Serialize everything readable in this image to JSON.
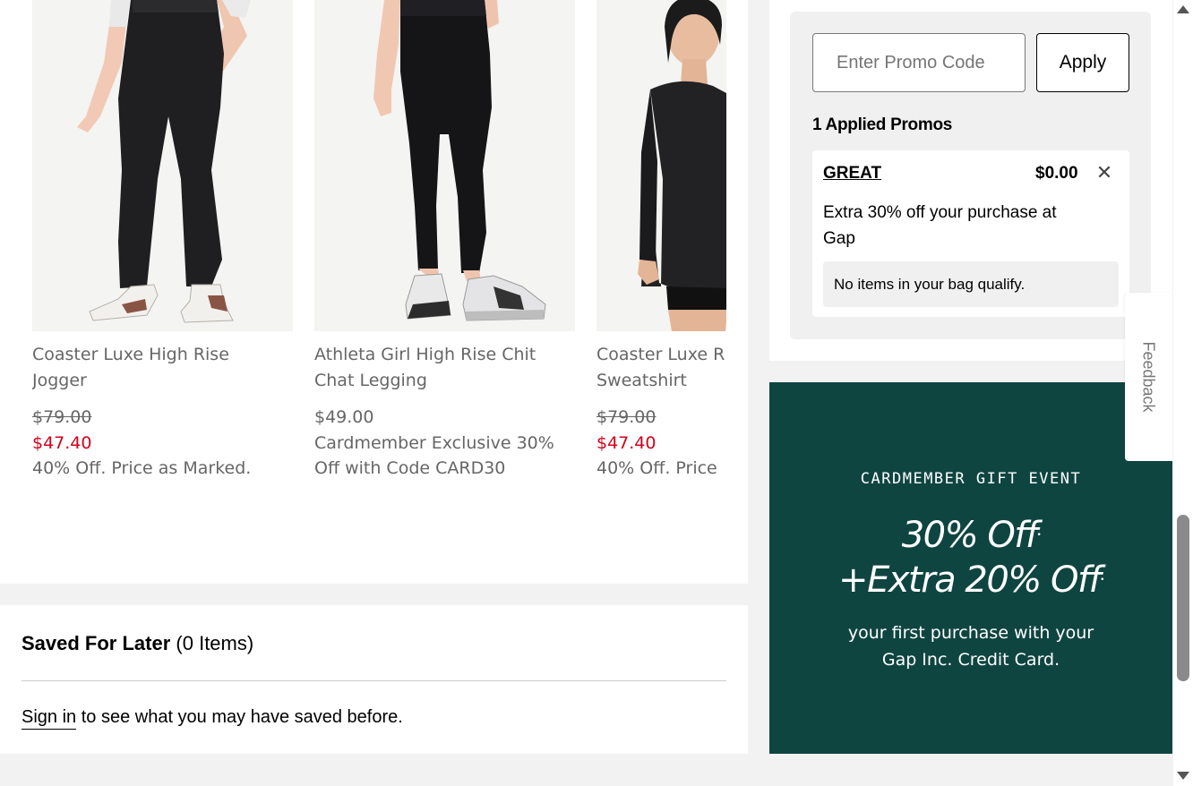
{
  "products": [
    {
      "name": "Coaster Luxe High Rise\nJogger",
      "original_price": "$79.00",
      "sale_price": "$47.40",
      "promo_note": "40% Off. Price as Marked."
    },
    {
      "name": "Athleta Girl High Rise Chit\nChat Legging",
      "price": "$49.00",
      "promo_note": "Cardmember Exclusive 30%\nOff with Code CARD30"
    },
    {
      "name": "Coaster Luxe R\nSweatshirt",
      "original_price": "$79.00",
      "sale_price": "$47.40",
      "promo_note": "40% Off. Price"
    }
  ],
  "saved_for_later": {
    "title": "Saved For Later",
    "count": "(0 Items)",
    "sign_in_link": "Sign in",
    "sign_in_text": " to see what you may have saved before."
  },
  "promo": {
    "input_placeholder": "Enter Promo Code",
    "apply_label": "Apply",
    "applied_title": "1 Applied Promos",
    "applied": {
      "code": "GREAT",
      "amount": "$0.00",
      "close_glyph": "✕",
      "description": "Extra 30% off your purchase at Gap",
      "qualify_message": "No items in your bag qualify."
    }
  },
  "banner": {
    "eyebrow": "CARDMEMBER GIFT EVENT",
    "line1": "30% Off",
    "line2": "+Extra 20% Off",
    "sub": "your first purchase with your\nGap Inc. Credit Card.",
    "background_color": "#0f4541"
  },
  "feedback": {
    "label": "Feedback"
  },
  "colors": {
    "sale_red": "#d0021b",
    "page_gray": "#f2f2f2"
  }
}
